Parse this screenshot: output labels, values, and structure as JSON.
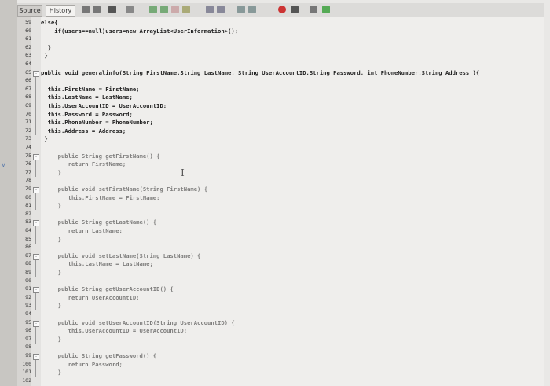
{
  "tabs": {
    "source": "Source",
    "history": "History"
  },
  "toolbar_icons": [
    "back-icon",
    "forward-icon",
    "toggle-icon",
    "search-icon",
    "find-prev-icon",
    "find-next-icon",
    "highlight-icon",
    "bookmark-icon",
    "shift-left-icon",
    "shift-right-icon",
    "comment-icon",
    "uncomment-icon",
    "record-icon",
    "stop-icon",
    "chart-icon",
    "run-icon"
  ],
  "colors": {
    "keyword": "#1e1ea8",
    "field": "#1b7a2a",
    "background": "#efeeec",
    "gutter": "#d6d4d1"
  },
  "lines": [
    {
      "num": "59",
      "text": "else{"
    },
    {
      "num": "60",
      "text": "    if(users==null)users=new ArrayList<UserInformation>();"
    },
    {
      "num": "61",
      "text": ""
    },
    {
      "num": "62",
      "text": "  }"
    },
    {
      "num": "63",
      "text": " }"
    },
    {
      "num": "64",
      "text": ""
    },
    {
      "num": "65",
      "text": "public void generalinfo(String FirstName,String LastName, String UserAccountID,String Password, int PhoneNumber,String Address ){"
    },
    {
      "num": "66",
      "text": ""
    },
    {
      "num": "67",
      "text": "  this.FirstName = FirstName;"
    },
    {
      "num": "68",
      "text": "  this.LastName = LastName;"
    },
    {
      "num": "69",
      "text": "  this.UserAccountID = UserAccountID;"
    },
    {
      "num": "70",
      "text": "  this.Password = Password;"
    },
    {
      "num": "71",
      "text": "  this.PhoneNumber = PhoneNumber;"
    },
    {
      "num": "72",
      "text": "  this.Address = Address;"
    },
    {
      "num": "73",
      "text": " }"
    },
    {
      "num": "74",
      "text": ""
    },
    {
      "num": "75",
      "text": "     public String getFirstName() {"
    },
    {
      "num": "76",
      "text": "        return FirstName;"
    },
    {
      "num": "77",
      "text": "     }"
    },
    {
      "num": "78",
      "text": ""
    },
    {
      "num": "79",
      "text": "     public void setFirstName(String FirstName) {"
    },
    {
      "num": "80",
      "text": "        this.FirstName = FirstName;"
    },
    {
      "num": "81",
      "text": "     }"
    },
    {
      "num": "82",
      "text": ""
    },
    {
      "num": "83",
      "text": "     public String getLastName() {"
    },
    {
      "num": "84",
      "text": "        return LastName;"
    },
    {
      "num": "85",
      "text": "     }"
    },
    {
      "num": "86",
      "text": ""
    },
    {
      "num": "87",
      "text": "     public void setLastName(String LastName) {"
    },
    {
      "num": "88",
      "text": "        this.LastName = LastName;"
    },
    {
      "num": "89",
      "text": "     }"
    },
    {
      "num": "90",
      "text": ""
    },
    {
      "num": "91",
      "text": "     public String getUserAccountID() {"
    },
    {
      "num": "92",
      "text": "        return UserAccountID;"
    },
    {
      "num": "93",
      "text": "     }"
    },
    {
      "num": "94",
      "text": ""
    },
    {
      "num": "95",
      "text": "     public void setUserAccountID(String UserAccountID) {"
    },
    {
      "num": "96",
      "text": "        this.UserAccountID = UserAccountID;"
    },
    {
      "num": "97",
      "text": "     }"
    },
    {
      "num": "98",
      "text": ""
    },
    {
      "num": "99",
      "text": "     public String getPassword() {"
    },
    {
      "num": "100",
      "text": "        return Password;"
    },
    {
      "num": "101",
      "text": "     }"
    },
    {
      "num": "102",
      "text": ""
    }
  ]
}
